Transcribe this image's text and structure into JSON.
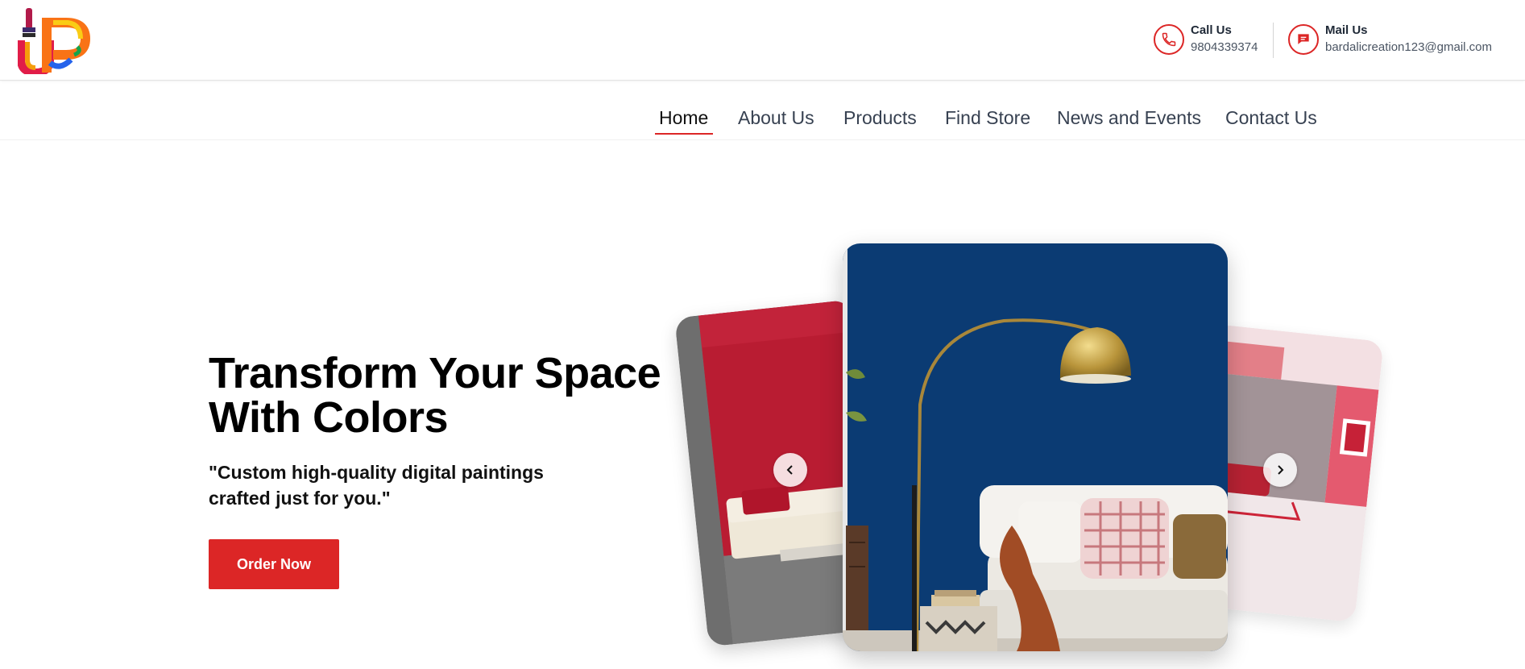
{
  "header": {
    "call": {
      "label": "Call Us",
      "value": "9804339374"
    },
    "mail": {
      "label": "Mail Us",
      "value": "bardalicreation123@gmail.com"
    }
  },
  "nav": {
    "items": [
      "Home",
      "About Us",
      "Products",
      "Find Store",
      "News and Events",
      "Contact Us"
    ],
    "active": "Home"
  },
  "hero": {
    "headline_line1": "Transform Your Space",
    "headline_line2": "With Colors",
    "subline_line1": "\"Custom high-quality digital paintings",
    "subline_line2": "crafted just for you.\"",
    "cta_label": "Order Now"
  },
  "colors": {
    "accent": "#dc2626",
    "nav_text": "#374151",
    "center_wall": "#0b3b73"
  },
  "icons": {
    "call": "phone-icon",
    "mail": "message-icon",
    "prev": "chevron-left-icon",
    "next": "chevron-right-icon"
  }
}
